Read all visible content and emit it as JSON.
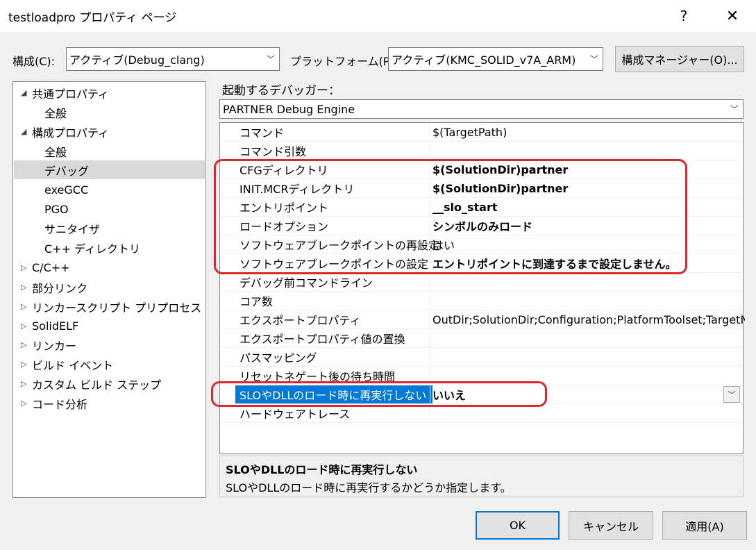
{
  "window": {
    "title": "testloadpro プロパティ ページ",
    "help_glyph": "?",
    "close_glyph": "✕"
  },
  "toolbar": {
    "config_label": "構成(C):",
    "config_value": "アクティブ(Debug_clang)",
    "platform_label": "プラットフォーム(P):",
    "platform_value": "アクティブ(KMC_SOLID_v7A_ARM)",
    "config_manager_label": "構成マネージャー(O)..."
  },
  "tree": {
    "items": [
      {
        "label": "共通プロパティ",
        "expander": "◢"
      },
      {
        "label": "全般"
      },
      {
        "label": "構成プロパティ",
        "expander": "◢"
      },
      {
        "label": "全般"
      },
      {
        "label": "デバッグ",
        "selected": true
      },
      {
        "label": "exeGCC"
      },
      {
        "label": "PGO"
      },
      {
        "label": "サニタイザ"
      },
      {
        "label": "C++ ディレクトリ"
      },
      {
        "label": "C/C++",
        "expander": "▷"
      },
      {
        "label": "部分リンク",
        "expander": "▷"
      },
      {
        "label": "リンカースクリプト プリプロセス",
        "expander": "▷"
      },
      {
        "label": "SolidELF",
        "expander": "▷"
      },
      {
        "label": "リンカー",
        "expander": "▷"
      },
      {
        "label": "ビルド イベント",
        "expander": "▷"
      },
      {
        "label": "カスタム ビルド ステップ",
        "expander": "▷"
      },
      {
        "label": "コード分析",
        "expander": "▷"
      }
    ]
  },
  "debugger": {
    "label": "起動するデバッガー：",
    "value": "PARTNER Debug Engine"
  },
  "properties": [
    {
      "name": "コマンド",
      "value": "$(TargetPath)",
      "bold": false
    },
    {
      "name": "コマンド引数",
      "value": "",
      "bold": false
    },
    {
      "name": "CFGディレクトリ",
      "value": "$(SolutionDir)partner",
      "bold": true
    },
    {
      "name": "INIT.MCRディレクトリ",
      "value": "$(SolutionDir)partner",
      "bold": true
    },
    {
      "name": "エントリポイント",
      "value": " __slo_start",
      "bold": true
    },
    {
      "name": "ロードオプション",
      "value": "シンボルのみロード",
      "bold": true
    },
    {
      "name": "ソフトウェアブレークポイントの再設定",
      "value": "はい",
      "bold": false
    },
    {
      "name": "ソフトウェアブレークポイントの設定",
      "value": "エントリポイントに到達するまで設定しません。",
      "bold": true
    },
    {
      "name": "デバッグ前コマンドライン",
      "value": "",
      "bold": false
    },
    {
      "name": "コア数",
      "value": "",
      "bold": false
    },
    {
      "name": "エクスポートプロパティ",
      "value": "OutDir;SolutionDir;Configuration;PlatformToolset;TargetN",
      "bold": false
    },
    {
      "name": "エクスポートプロパティ値の置換",
      "value": "",
      "bold": false
    },
    {
      "name": "パスマッピング",
      "value": "",
      "bold": false
    },
    {
      "name": "リセットネゲート後の待ち時間",
      "value": "",
      "bold": false
    },
    {
      "name": "SLOやDLLのロード時に再実行しない",
      "value": "いいえ",
      "bold": true,
      "selected": true
    },
    {
      "name": "ハードウェアトレース",
      "value": "",
      "bold": false
    }
  ],
  "description": {
    "title": "SLOやDLLのロード時に再実行しない",
    "text": "SLOやDLLのロード時に再実行するかどうか指定します。"
  },
  "buttons": {
    "ok": "OK",
    "cancel": "キャンセル",
    "apply": "適用(A)"
  },
  "colors": {
    "selection": "#0078d7",
    "highlight_box": "#e0262a"
  }
}
